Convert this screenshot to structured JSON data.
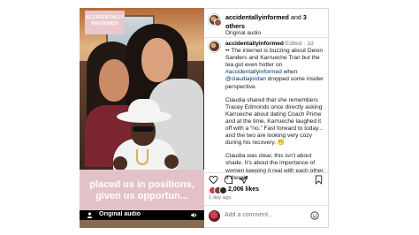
{
  "media": {
    "brand_line1": "ACCIDENTALLY",
    "brand_line2": "INFORMED",
    "caption_line1": "placed us in positions,",
    "caption_line2": "given us opportun...",
    "audio_label": "Original audio"
  },
  "header": {
    "username": "accidentallyinformed",
    "and_text": "and",
    "others_text": "3 others",
    "audio": "Original audio"
  },
  "post": {
    "username": "accidentallyinformed",
    "edited": "Edited",
    "time": "1d",
    "paragraph1_a": "•• The internet is buzzing about Deion Sanders and Karrueche Tran but the tea got even hotter on ",
    "hashtag": "#accidentallyinformed",
    "paragraph1_b": " when ",
    "mention": "@claudiajordan",
    "paragraph1_c": " dropped some insider perspective.",
    "paragraph2": "Claudia shared that she remembers Tracey Edmonds once directly asking Karrueche about dating Coach Prime and at the time, Karrueche laughed it off with a “no.” Fast forward to today... and the two are looking very cozy during his recovery. 😬",
    "paragraph3": "Claudia was clear, this isn’t about shade. It’s about the importance of women keeping it real with each other. If there’s"
  },
  "engagement": {
    "likes": "2,006 likes",
    "date": "1 day ago"
  },
  "comment": {
    "placeholder": "Add a comment..."
  },
  "colors": {
    "caption_band": "#e3c1c8",
    "link": "#00376b",
    "muted": "#737373"
  },
  "icons": [
    "user-icon",
    "speaker-icon",
    "heart-icon",
    "comment-icon",
    "share-icon",
    "bookmark-icon",
    "emoji-icon"
  ]
}
